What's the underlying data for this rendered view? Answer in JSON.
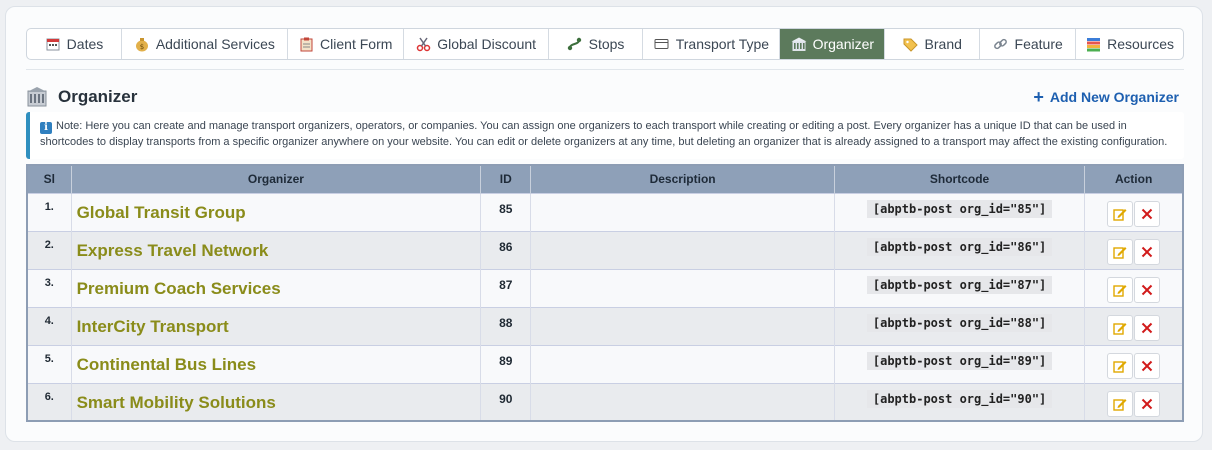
{
  "tabs": [
    {
      "label": "Dates",
      "icon": "calendar-icon",
      "active": false
    },
    {
      "label": "Additional Services",
      "icon": "money-bag-icon",
      "active": false
    },
    {
      "label": "Client Form",
      "icon": "clipboard-icon",
      "active": false
    },
    {
      "label": "Global Discount",
      "icon": "scissors-icon",
      "active": false
    },
    {
      "label": "Stops",
      "icon": "route-icon",
      "active": false
    },
    {
      "label": "Transport Type",
      "icon": "card-icon",
      "active": false
    },
    {
      "label": "Organizer",
      "icon": "building-icon",
      "active": true
    },
    {
      "label": "Brand",
      "icon": "tag-icon",
      "active": false
    },
    {
      "label": "Feature",
      "icon": "link-icon",
      "active": false
    },
    {
      "label": "Resources",
      "icon": "books-icon",
      "active": false
    }
  ],
  "header": {
    "title": "Organizer",
    "add_label": "Add New Organizer"
  },
  "note": {
    "text": "Note: Here you can create and manage transport organizers, operators, or companies. You can assign one organizers to each transport while creating or editing a post. Every organizer has a unique ID that can be used in shortcodes to display transports from a specific organizer anywhere on your website. You can edit or delete organizers at any time, but deleting an organizer that is already assigned to a transport may affect the existing configuration."
  },
  "table": {
    "columns": [
      "Sl",
      "Organizer",
      "ID",
      "Description",
      "Shortcode",
      "Action"
    ],
    "rows": [
      {
        "sl": "1.",
        "name": "Global Transit Group",
        "id": "85",
        "description": "",
        "shortcode": "[abptb-post org_id=\"85\"]"
      },
      {
        "sl": "2.",
        "name": "Express Travel Network",
        "id": "86",
        "description": "",
        "shortcode": "[abptb-post org_id=\"86\"]"
      },
      {
        "sl": "3.",
        "name": "Premium Coach Services",
        "id": "87",
        "description": "",
        "shortcode": "[abptb-post org_id=\"87\"]"
      },
      {
        "sl": "4.",
        "name": "InterCity Transport",
        "id": "88",
        "description": "",
        "shortcode": "[abptb-post org_id=\"88\"]"
      },
      {
        "sl": "5.",
        "name": "Continental Bus Lines",
        "id": "89",
        "description": "",
        "shortcode": "[abptb-post org_id=\"89\"]"
      },
      {
        "sl": "6.",
        "name": "Smart Mobility Solutions",
        "id": "90",
        "description": "",
        "shortcode": "[abptb-post org_id=\"90\"]"
      }
    ]
  },
  "colors": {
    "active_tab": "#5c7a5c",
    "organizer_name": "#8a8c1a",
    "add_link": "#1d5fb0",
    "header_row": "#8ea0b8",
    "note_border": "#2f8fbf",
    "delete": "#d11a1a",
    "edit": "#e0a800"
  }
}
